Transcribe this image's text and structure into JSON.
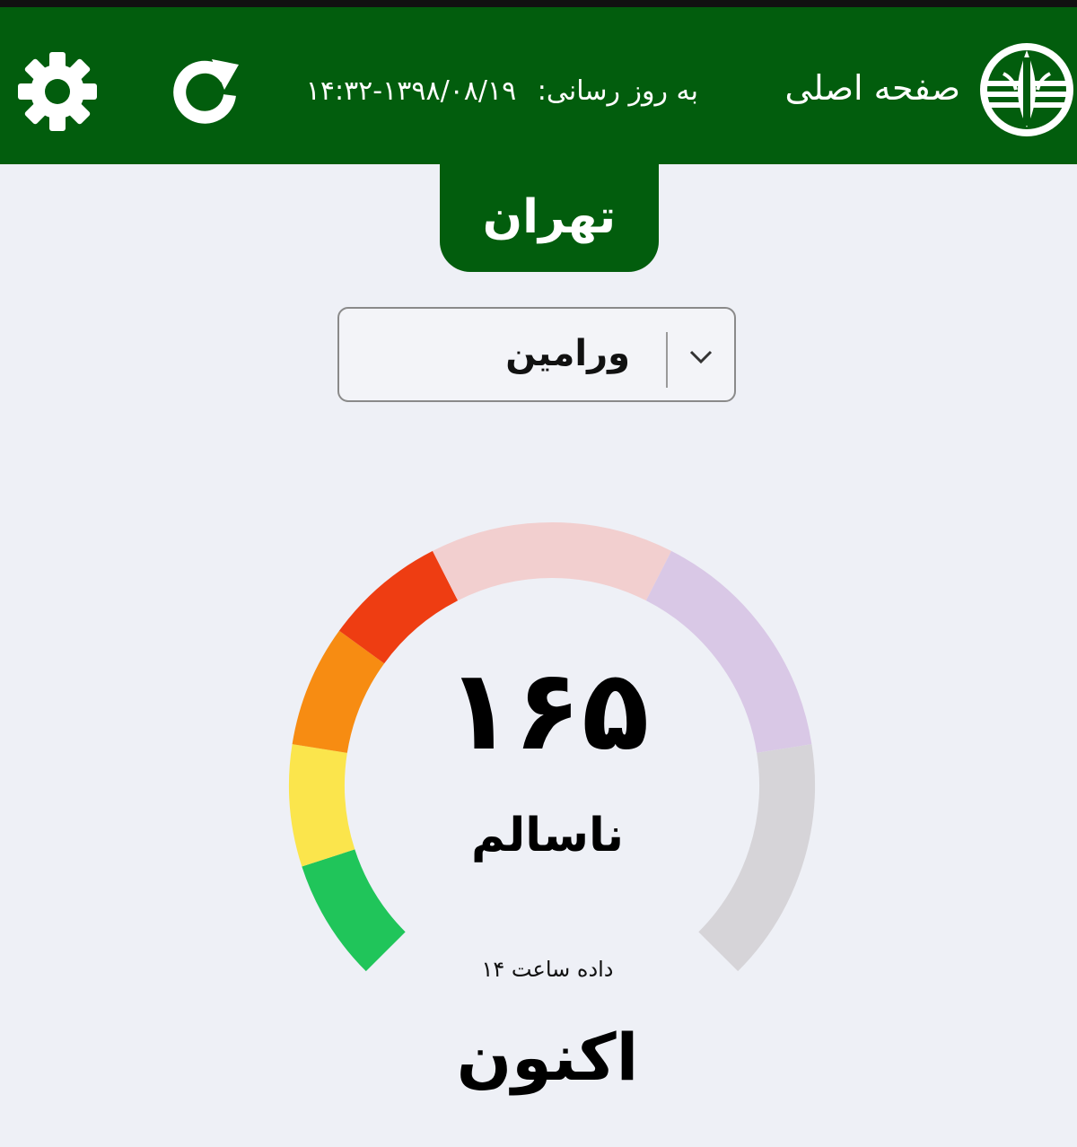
{
  "header": {
    "home_label": "صفحه اصلی",
    "updated_label": "به روز رسانی:",
    "updated_value": "۱۳۹۸/۰۸/۱۹-۱۴:۳۲",
    "refresh_icon": "refresh-icon",
    "settings_icon": "gear-icon",
    "logo_icon": "org-logo-icon"
  },
  "city": {
    "name": "تهران"
  },
  "station_select": {
    "selected": "ورامین",
    "icon": "chevron-down-icon"
  },
  "aqi": {
    "value": "۱۶۵",
    "numeric_value": 165,
    "status": "ناسالم",
    "data_hour_label": "داده ساعت ۱۴",
    "period_label": "اکنون",
    "gauge_segments": [
      {
        "color": "#20c55a",
        "from": 0,
        "to": 50
      },
      {
        "color": "#fbe54c",
        "from": 50,
        "to": 100
      },
      {
        "color": "#f78c12",
        "from": 100,
        "to": 150
      },
      {
        "color": "#ee3d12",
        "from": 150,
        "to": 200
      },
      {
        "color": "#f2cfcf",
        "from": 200,
        "to": 300
      },
      {
        "color": "#d9c8e6",
        "from": 300,
        "to": 400
      },
      {
        "color": "#d6d4d8",
        "from": 400,
        "to": 500
      }
    ]
  },
  "colors": {
    "brand_green": "#025d0d",
    "background": "#eef0f6"
  }
}
